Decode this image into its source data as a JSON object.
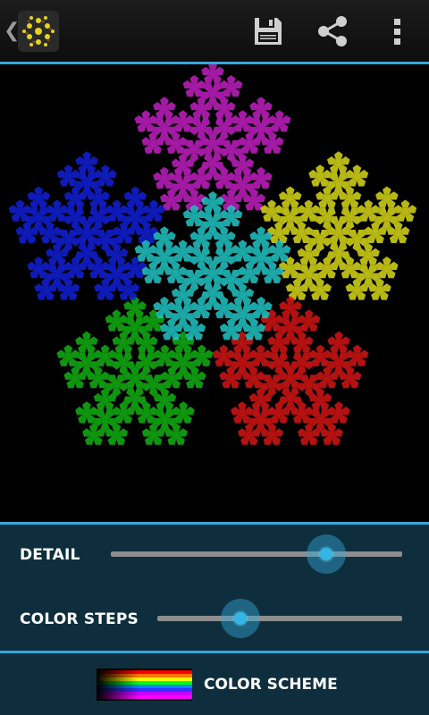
{
  "actionbar": {
    "app_icon": "fractal-app-icon",
    "actions": [
      "save-icon",
      "share-icon",
      "overflow-menu-icon"
    ]
  },
  "canvas": {
    "fractal": "pentaflake",
    "colors": {
      "magenta": "#c21fc2",
      "blue": "#1020d8",
      "cyan": "#22c6c6",
      "yellow": "#d8d818",
      "green": "#12b012",
      "red": "#d41414"
    }
  },
  "controls": {
    "detail": {
      "label": "DETAIL",
      "value": 0.74
    },
    "color_steps": {
      "label": "COLOR STEPS",
      "value": 0.34
    }
  },
  "color_scheme": {
    "label": "COLOR SCHEME",
    "swatch_colors": [
      "#ff0000",
      "#ff7700",
      "#ffff00",
      "#00ff00",
      "#0088ff",
      "#3333ff",
      "#cc00ff",
      "#ff00ff"
    ]
  },
  "accent_color": "#33a8d9"
}
